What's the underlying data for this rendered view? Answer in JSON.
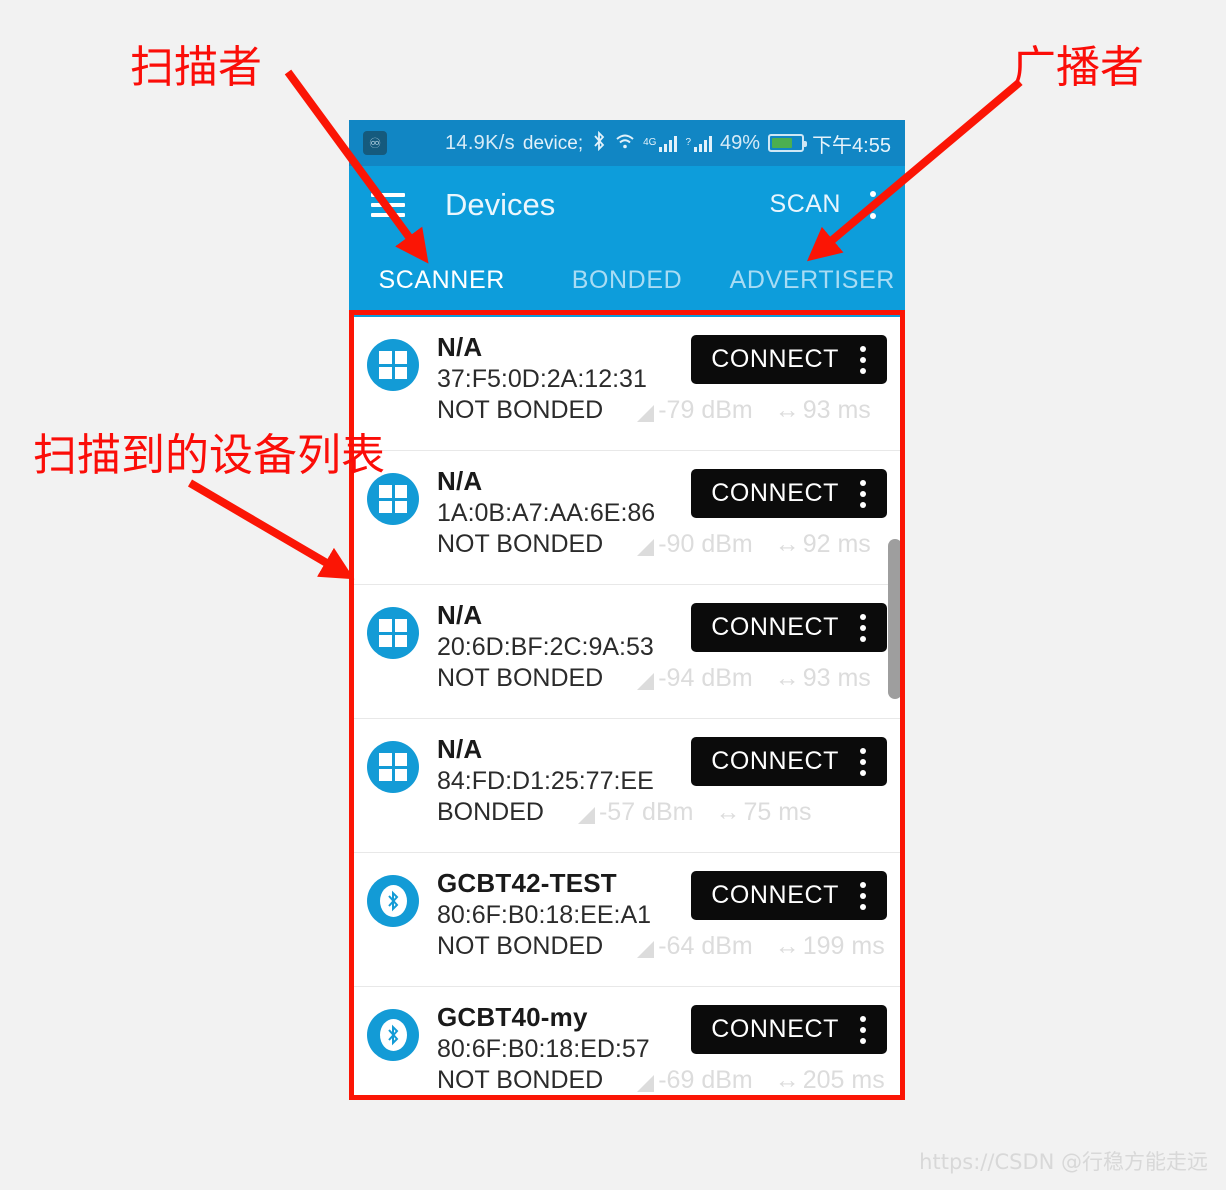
{
  "statusbar": {
    "shield_icon": "shield-icon",
    "network_speed": "14.9K/s",
    "bluetooth_icon": "bluetooth-icon",
    "wifi_icon": "wifi-icon",
    "mobile_net_label": "4G",
    "sim2_label": "?",
    "battery_percent": "49%",
    "time": "下午4:55"
  },
  "appbar": {
    "menu_icon": "hamburger-menu-icon",
    "title": "Devices",
    "scan_label": "SCAN",
    "overflow_icon": "overflow-menu-icon"
  },
  "tabs": [
    {
      "label": "SCANNER",
      "active": true
    },
    {
      "label": "BONDED",
      "active": false
    },
    {
      "label": "ADVERTISER",
      "active": false
    }
  ],
  "devices": [
    {
      "icon": "unknown-device-icon",
      "name": "N/A",
      "address": "37:F5:0D:2A:12:31",
      "bond_state": "NOT BONDED",
      "rssi": "-79 dBm",
      "latency": "93 ms",
      "action_label": "CONNECT"
    },
    {
      "icon": "unknown-device-icon",
      "name": "N/A",
      "address": "1A:0B:A7:AA:6E:86",
      "bond_state": "NOT BONDED",
      "rssi": "-90 dBm",
      "latency": "92 ms",
      "action_label": "CONNECT"
    },
    {
      "icon": "unknown-device-icon",
      "name": "N/A",
      "address": "20:6D:BF:2C:9A:53",
      "bond_state": "NOT BONDED",
      "rssi": "-94 dBm",
      "latency": "93 ms",
      "action_label": "CONNECT"
    },
    {
      "icon": "unknown-device-icon",
      "name": "N/A",
      "address": "84:FD:D1:25:77:EE",
      "bond_state": "BONDED",
      "rssi": "-57 dBm",
      "latency": "75 ms",
      "action_label": "CONNECT"
    },
    {
      "icon": "bluetooth-device-icon",
      "name": "GCBT42-TEST",
      "address": "80:6F:B0:18:EE:A1",
      "bond_state": "NOT BONDED",
      "rssi": "-64 dBm",
      "latency": "199 ms",
      "action_label": "CONNECT"
    },
    {
      "icon": "bluetooth-device-icon",
      "name": "GCBT40-my",
      "address": "80:6F:B0:18:ED:57",
      "bond_state": "NOT BONDED",
      "rssi": "-69 dBm",
      "latency": "205 ms",
      "action_label": "CONNECT"
    }
  ],
  "annotations": {
    "scanner": "扫描者",
    "advertiser": "广播者",
    "device_list": "扫描到的设备列表",
    "color": "#fb0d08"
  },
  "watermark": "https://CSDN @行稳方能走远",
  "colors": {
    "appbar": "#0d9ddb",
    "statusbar": "#1186c4",
    "accent": "#139bd6",
    "button": "#0b0b0b",
    "annotation": "#fb0d08"
  }
}
